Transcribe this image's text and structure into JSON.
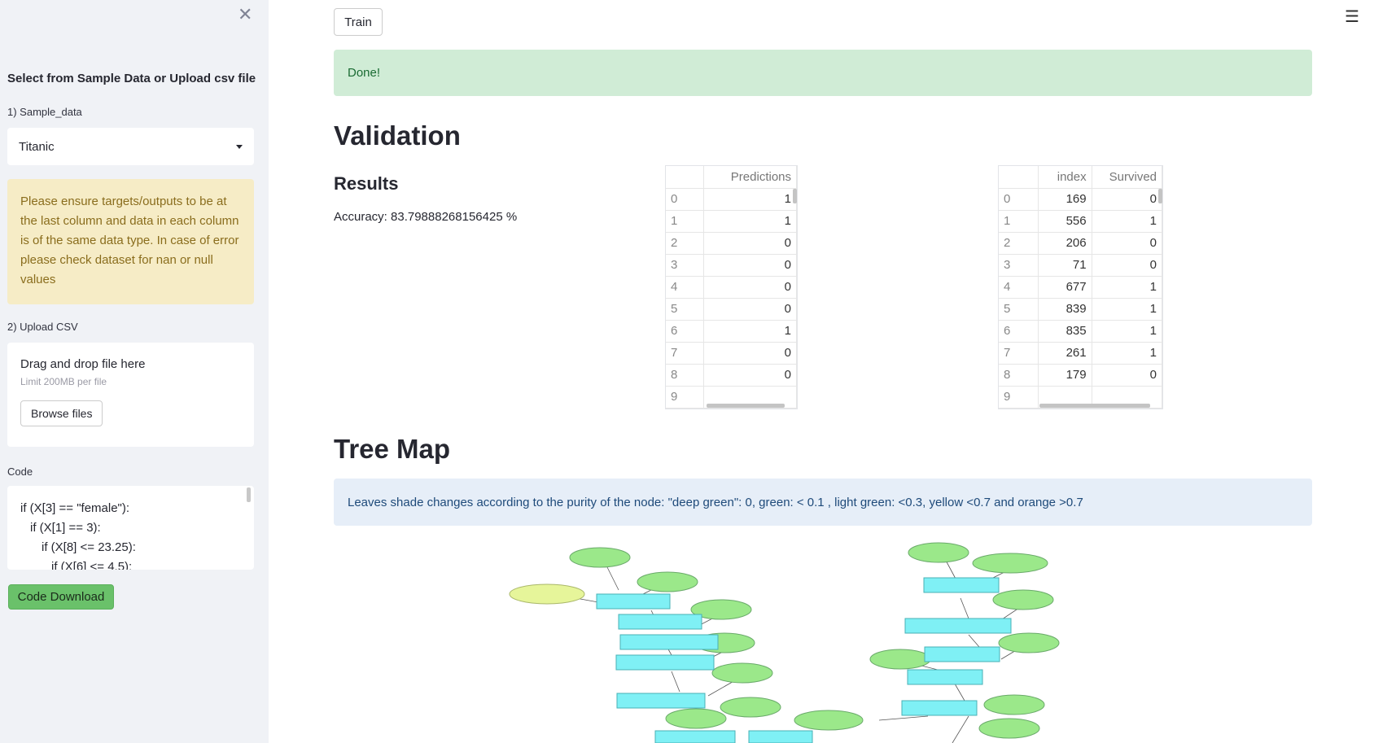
{
  "sidebar": {
    "title": "Select from Sample Data or Upload csv file",
    "sample_label": "1) Sample_data",
    "sample_value": "Titanic",
    "warning": "Please ensure targets/outputs to be at the last column and data in each column is of the same data type. In case of error please check dataset for nan or null values",
    "upload_label": "2) Upload CSV",
    "drop_text": "Drag and drop file here",
    "limit_text": "Limit 200MB per file",
    "browse_label": "Browse files",
    "code_label": "Code",
    "code_lines": [
      "if (X[3] == \"female\"):",
      "  if (X[1] == 3):",
      "    if (X[8] <= 23.25):",
      "      if (X[6] <= 4.5):"
    ],
    "code_download": "Code Download"
  },
  "main": {
    "train_label": "Train",
    "done_text": "Done!",
    "validation_heading": "Validation",
    "results_heading": "Results",
    "accuracy_text": "Accuracy: 83.79888268156425 %",
    "tree_heading": "Tree Map",
    "info_text": "Leaves shade changes according to the purity of the node: \"deep green\": 0, green: < 0.1 , light green: <0.3, yellow <0.7 and orange >0.7"
  },
  "predictions_table": {
    "columns": [
      "",
      "Predictions"
    ],
    "rows": [
      [
        "0",
        "1"
      ],
      [
        "1",
        "1"
      ],
      [
        "2",
        "0"
      ],
      [
        "3",
        "0"
      ],
      [
        "4",
        "0"
      ],
      [
        "5",
        "0"
      ],
      [
        "6",
        "1"
      ],
      [
        "7",
        "0"
      ],
      [
        "8",
        "0"
      ],
      [
        "9",
        ""
      ]
    ]
  },
  "actuals_table": {
    "columns": [
      "",
      "index",
      "Survived"
    ],
    "rows": [
      [
        "0",
        "169",
        "0"
      ],
      [
        "1",
        "556",
        "1"
      ],
      [
        "2",
        "206",
        "0"
      ],
      [
        "3",
        "71",
        "0"
      ],
      [
        "4",
        "677",
        "1"
      ],
      [
        "5",
        "839",
        "1"
      ],
      [
        "6",
        "835",
        "1"
      ],
      [
        "7",
        "261",
        "1"
      ],
      [
        "8",
        "179",
        "0"
      ],
      [
        "9",
        "",
        ""
      ]
    ]
  },
  "colors": {
    "node_leaf": "#9be88a",
    "node_yellow": "#e6f59a",
    "node_split": "#7ff0f5"
  }
}
